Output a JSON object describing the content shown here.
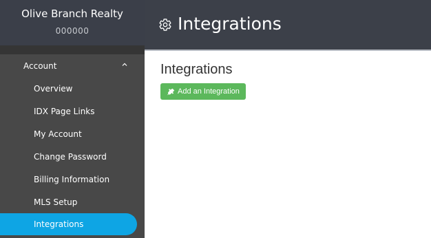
{
  "brand": {
    "name": "Olive Branch Realty",
    "id": "000000"
  },
  "sidebar": {
    "section_label": "Account",
    "items": [
      {
        "label": "Overview"
      },
      {
        "label": "IDX Page Links"
      },
      {
        "label": "My Account"
      },
      {
        "label": "Change Password"
      },
      {
        "label": "Billing Information"
      },
      {
        "label": "MLS Setup"
      },
      {
        "label": "Integrations",
        "active": true
      }
    ]
  },
  "header": {
    "title": "Integrations",
    "icon": "gear-icon"
  },
  "main": {
    "heading": "Integrations",
    "add_button": {
      "label": "Add an Integration",
      "icon": "plug-icon"
    }
  },
  "colors": {
    "sidebar_bg": "#484848",
    "brand_bg": "#3b3f49",
    "topbar_bg": "#3c4049",
    "active_item": "#0ea5e4",
    "button_green": "#5cb85c"
  }
}
